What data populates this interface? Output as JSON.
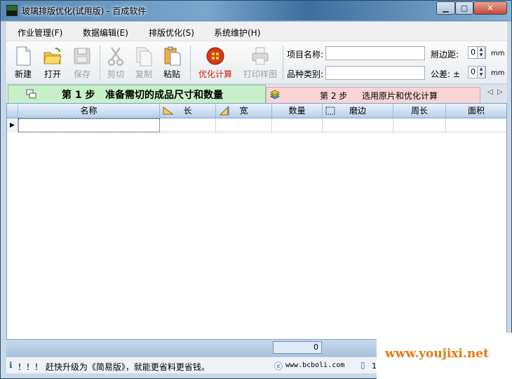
{
  "window": {
    "title": "玻璃排版优化(试用版) - 百成软件"
  },
  "menu": [
    "作业管理(F)",
    "数据编辑(E)",
    "排版优化(S)",
    "系统维护(H)"
  ],
  "toolbar": {
    "new": "新建",
    "open": "打开",
    "save": "保存",
    "cut": "剪切",
    "copy": "复制",
    "paste": "粘贴",
    "optimize": "优化计算",
    "print": "打印样图"
  },
  "fields": {
    "project_label": "项目名称:",
    "project_value": "",
    "variety_label": "品种类别:",
    "variety_value": "",
    "trim_label": "掰边距:",
    "trim_value": "0",
    "trim_unit": "mm",
    "tolerance_label": "公差: ±",
    "tolerance_value": "0",
    "tolerance_unit": "mm"
  },
  "tabs": {
    "step1_no": "第 1 步",
    "step1": "准备需切的成品尺寸和数量",
    "step2_no": "第 2 步",
    "step2": "选用原片和优化计算"
  },
  "grid": {
    "columns": [
      "名称",
      "长",
      "宽",
      "数量",
      "磨边",
      "周长",
      "面积"
    ]
  },
  "summary": {
    "count": "0"
  },
  "status": {
    "info": "！！！ 赶快升级为《简易版》，就能更省料更省钱。",
    "web": "www.bcboli.com",
    "phone": "1"
  },
  "watermark": "www.youjixi.net",
  "colors": {
    "step1_bg": "#c8f0c8",
    "step2_bg": "#f8d4d4",
    "optimize_text": "#cc2200"
  }
}
